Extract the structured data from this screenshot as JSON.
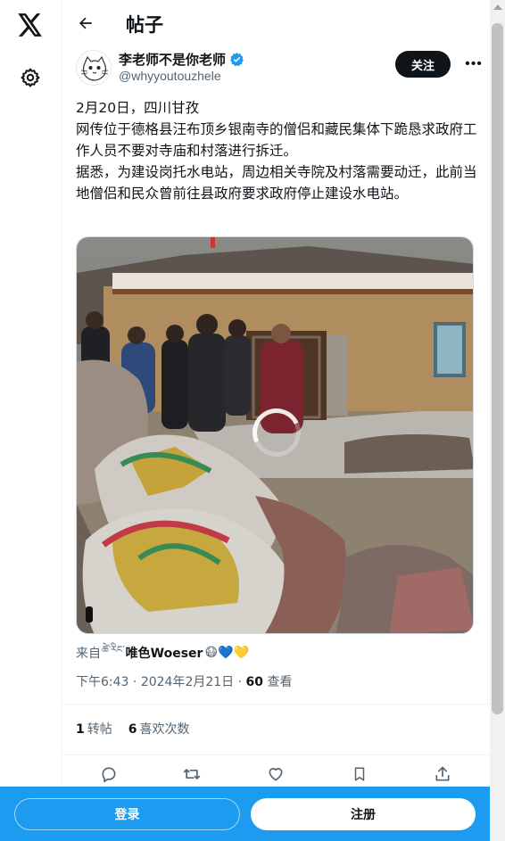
{
  "header": {
    "title": "帖子"
  },
  "author": {
    "name": "李老师不是你老师",
    "handle": "@whyyoutouzhele",
    "follow_label": "关注",
    "more_label": "•••"
  },
  "tweet": {
    "lines": [
      "2月20日，四川甘孜",
      "网传位于德格县汪布顶乡银南寺的僧侣和藏民集体下跪恳求政府工作人员不要对寺庙和村落进行拆迁。",
      "据悉，为建设岗托水电站，周边相关寺院及村落需要动迁，此前当地僧侣和民众曾前往县政府要求政府停止建设水电站。"
    ]
  },
  "source": {
    "prefix": "来自",
    "tibetan": "ཚེ་རིང་",
    "name": "唯色Woeser",
    "emojis": "😷💙💛"
  },
  "meta": {
    "time": "下午6:43",
    "separator": "·",
    "date": "2024年2月21日",
    "views_count": "60",
    "views_label": "查看"
  },
  "stats": {
    "retweets_count": "1",
    "retweets_label": "转帖",
    "likes_count": "6",
    "likes_label": "喜欢次数"
  },
  "bottom": {
    "login_label": "登录",
    "signup_label": "注册"
  },
  "colors": {
    "brand_blue": "#1d9bf0",
    "text_primary": "#0f1419",
    "text_secondary": "#536471"
  },
  "icons": {
    "logo": "x-logo-icon",
    "settings": "gear-icon",
    "back": "back-arrow-icon",
    "verified": "verified-badge-icon",
    "reply": "reply-icon",
    "retweet": "retweet-icon",
    "like": "heart-icon",
    "bookmark": "bookmark-icon",
    "share": "share-icon"
  }
}
